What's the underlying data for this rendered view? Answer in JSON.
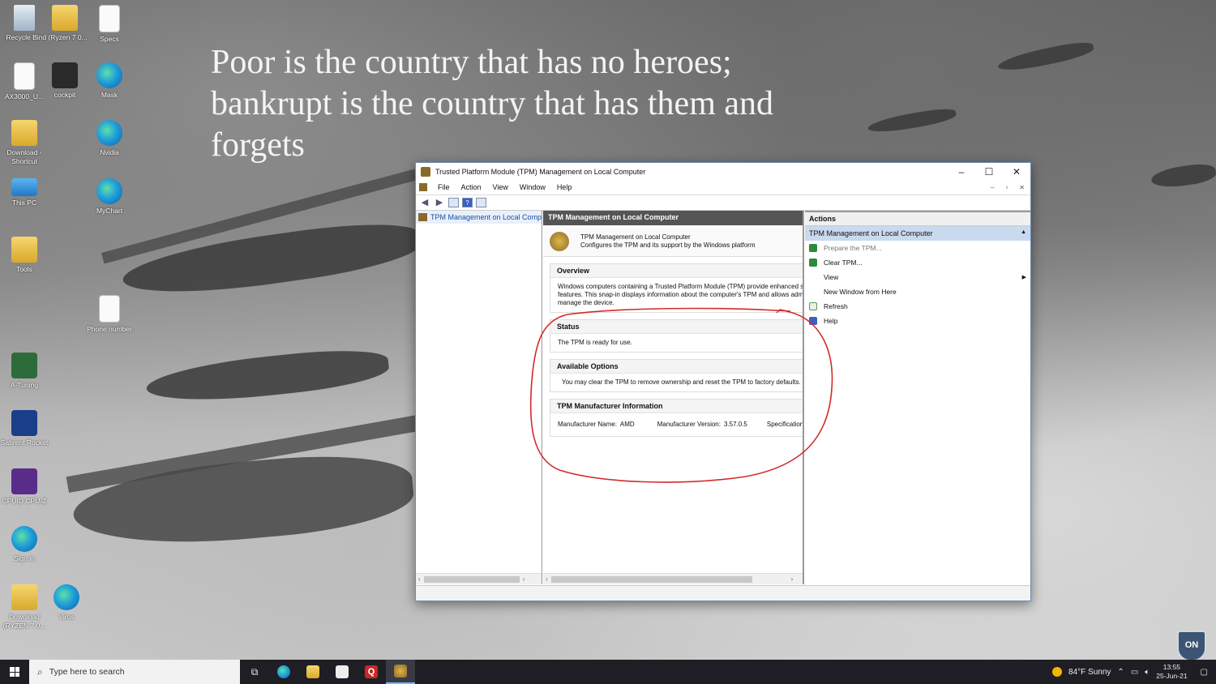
{
  "wallpaper": {
    "quote": "Poor is the country that has no heroes; bankrupt is the country that has them and forgets"
  },
  "desktop_icons": [
    {
      "label": "Recycle Bin",
      "icon": "recycle-bin-icon"
    },
    {
      "label": "d (Ryzen 7 0...",
      "icon": "folder-icon"
    },
    {
      "label": "Specs",
      "icon": "document-icon"
    },
    {
      "label": "AX3000_U...",
      "icon": "document-icon"
    },
    {
      "label": "cockpit",
      "icon": "image-icon"
    },
    {
      "label": "Mask",
      "icon": "edge-icon"
    },
    {
      "label": "Download - Shortcut",
      "icon": "shortcut-icon"
    },
    {
      "label": "Nvidia",
      "icon": "edge-icon"
    },
    {
      "label": "This PC",
      "icon": "pc-icon"
    },
    {
      "label": "MyChart",
      "icon": "edge-icon"
    },
    {
      "label": "Tools",
      "icon": "folder-icon"
    },
    {
      "label": "Phone number",
      "icon": "document-icon"
    },
    {
      "label": "A-Tuning",
      "icon": "app-icon"
    },
    {
      "label": "Sabrent Rocket",
      "icon": "app-icon"
    },
    {
      "label": "CPUID CPU-Z",
      "icon": "app-icon"
    },
    {
      "label": "Sign in",
      "icon": "edge-icon"
    },
    {
      "label": "Download (RYZEN 7 0...",
      "icon": "folder-icon"
    },
    {
      "label": "Virus",
      "icon": "edge-icon"
    }
  ],
  "window": {
    "title": "Trusted Platform Module (TPM) Management on Local Computer",
    "menu": [
      "File",
      "Action",
      "View",
      "Window",
      "Help"
    ],
    "tree_item": "TPM Management on Local Compu",
    "center": {
      "header": "TPM Management on Local Computer",
      "intro_line1": "TPM Management on Local Computer",
      "intro_line2": "Configures the TPM and its support by the Windows platform",
      "overview_title": "Overview",
      "overview_text1": "Windows computers containing a Trusted Platform Module (TPM) provide enhanced se",
      "overview_text2": "features. This snap-in displays information about the computer's TPM and allows admini",
      "overview_text3": "manage the device.",
      "status_title": "Status",
      "status_text": "The TPM is ready for use.",
      "options_title": "Available Options",
      "options_text": "You may clear the TPM to remove ownership and reset the TPM to factory defaults.",
      "mfr_title": "TPM Manufacturer Information",
      "mfr_name_label": "Manufacturer Name:",
      "mfr_name_value": "AMD",
      "mfr_version_label": "Manufacturer Version:",
      "mfr_version_value": "3.57.0.5",
      "spec_label": "Specification Ve"
    },
    "actions": {
      "header": "Actions",
      "group": "TPM Management on Local Computer",
      "items": [
        {
          "label": "Prepare the TPM...",
          "icon": "green-action-icon",
          "enabled": false
        },
        {
          "label": "Clear TPM...",
          "icon": "green-action-icon",
          "enabled": true
        },
        {
          "label": "View",
          "icon": "",
          "enabled": true,
          "submenu": true
        },
        {
          "label": "New Window from Here",
          "icon": "",
          "enabled": true
        },
        {
          "label": "Refresh",
          "icon": "refresh-icon",
          "enabled": true
        },
        {
          "label": "Help",
          "icon": "help-icon",
          "enabled": true
        }
      ]
    }
  },
  "taskbar": {
    "search_placeholder": "Type here to search",
    "weather": "84°F  Sunny",
    "time": "13:55",
    "date": "25-Jun-21"
  },
  "badge": "ON",
  "colors": {
    "annotation": "#d42a2a",
    "selection": "#c9d9ee",
    "pane_header": "#555555"
  }
}
